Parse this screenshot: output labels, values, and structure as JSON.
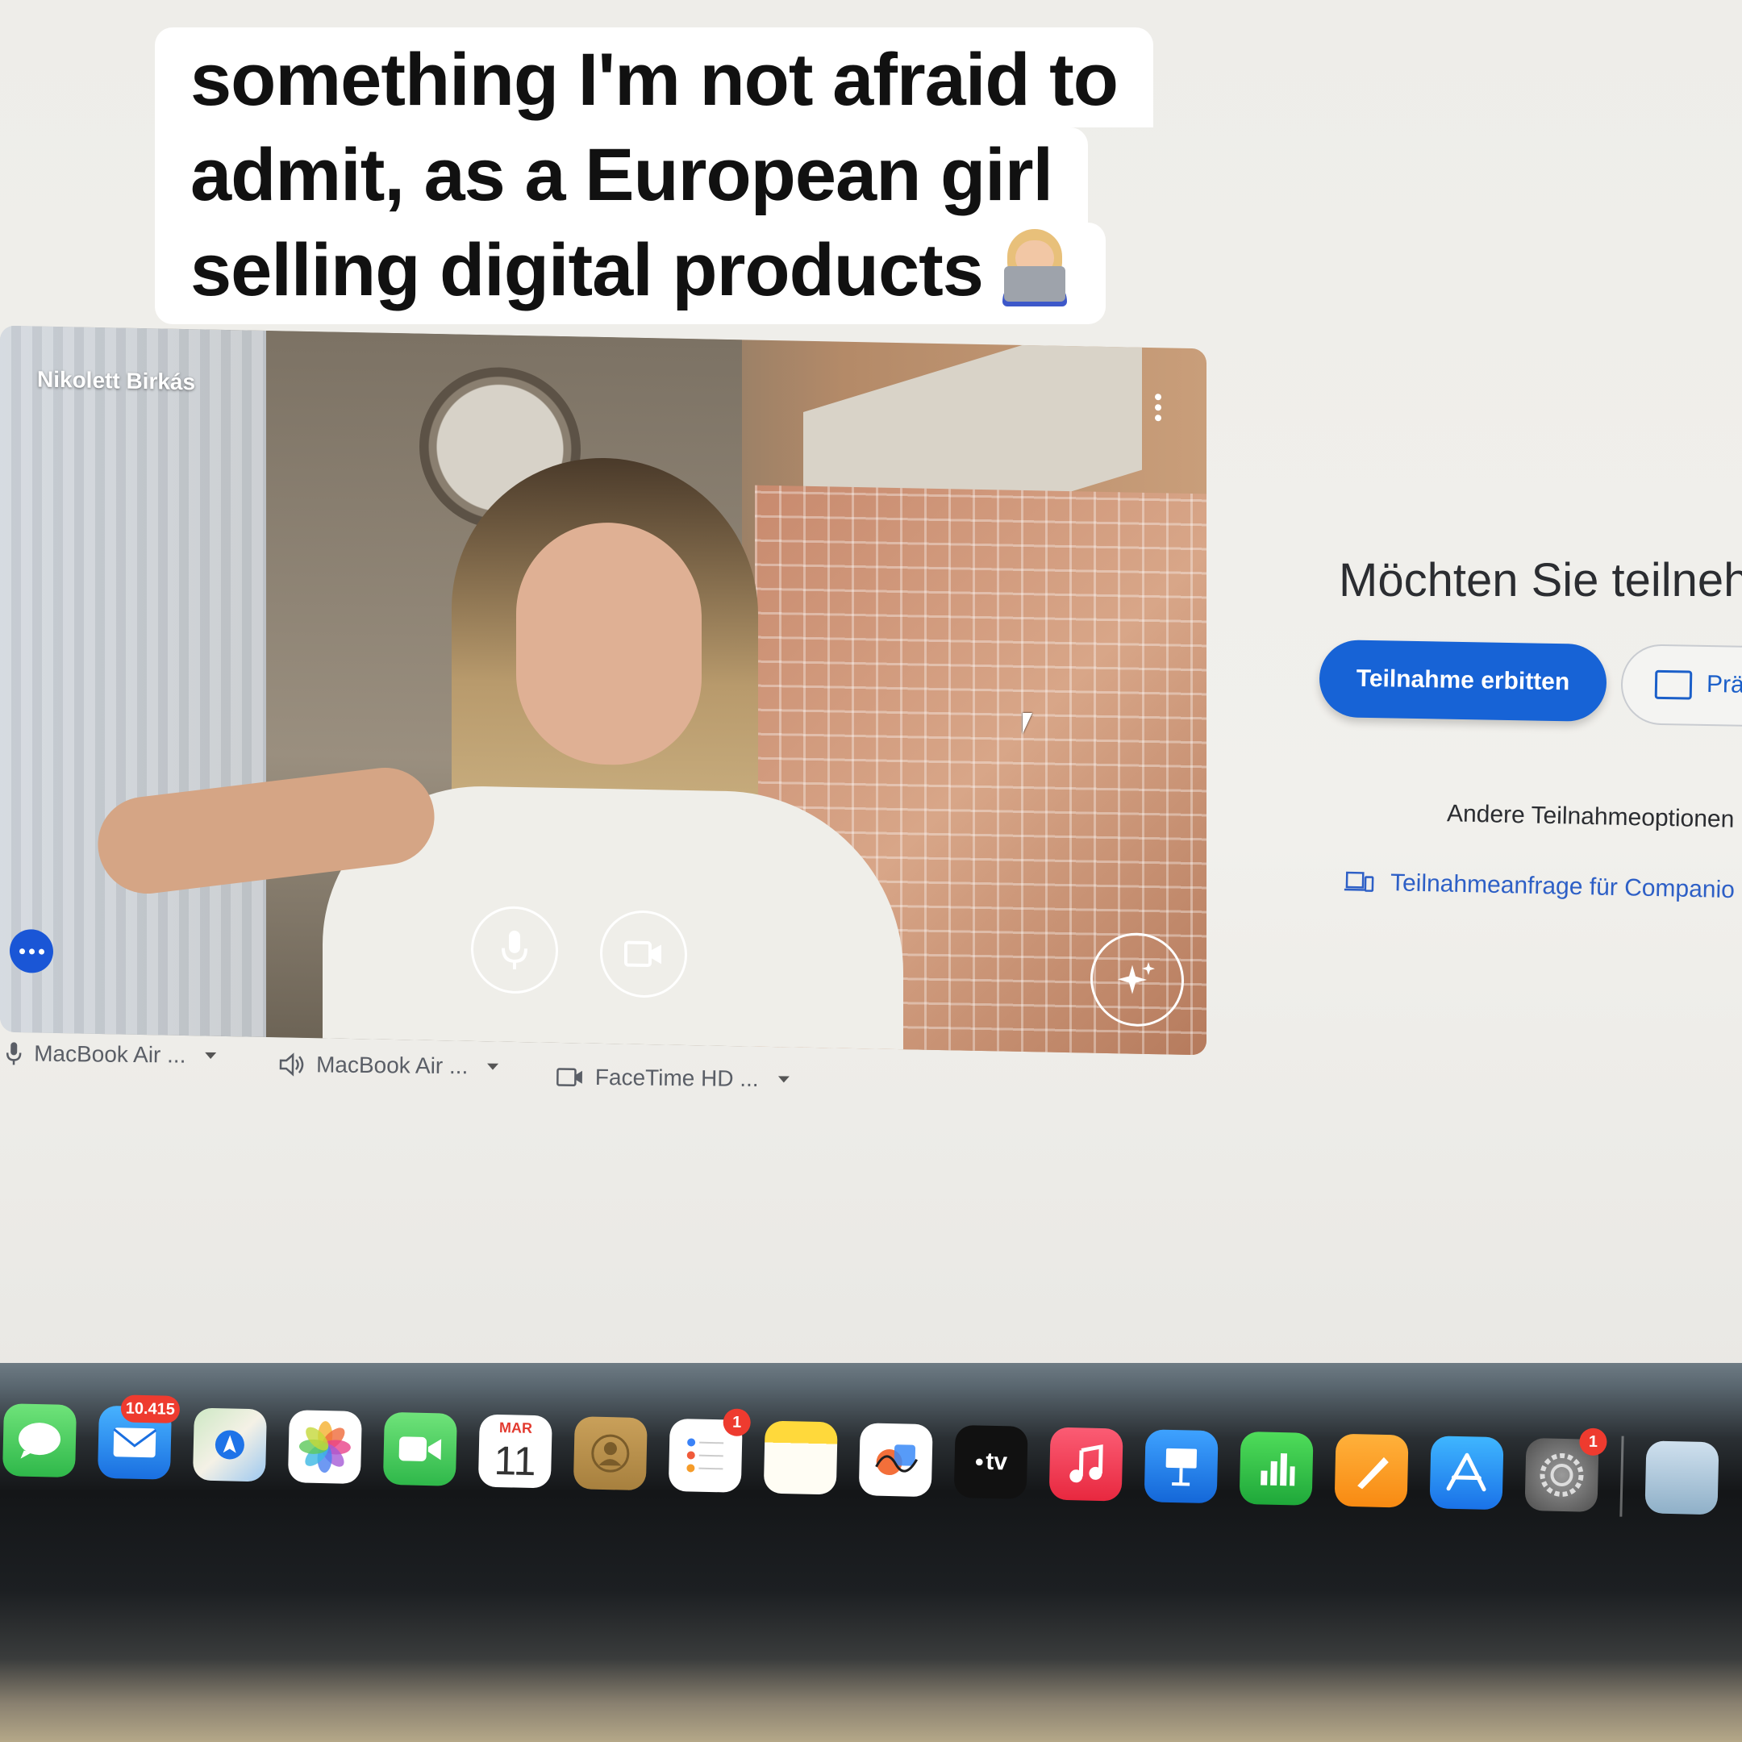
{
  "caption": {
    "line1": "something I'm not afraid to",
    "line2": "admit, as a European girl",
    "line3": "selling digital products"
  },
  "video_preview": {
    "participant_name": "Nikolett Birkás"
  },
  "devices": {
    "microphone": "MacBook Air ...",
    "speaker": "MacBook Air ...",
    "camera": "FaceTime HD ..."
  },
  "join_panel": {
    "title": "Möchten Sie teilneh",
    "ask_to_join": "Teilnahme erbitten",
    "present": "Prä",
    "other_options": "Andere Teilnahmeoptionen",
    "companion_request": "Teilnahmeanfrage für Companio"
  },
  "dock": {
    "mail_badge": "10.415",
    "calendar_month": "MAR",
    "calendar_day": "11",
    "reminders_badge": "1",
    "tv_label": "tv",
    "settings_badge": "1"
  },
  "colors": {
    "accent_blue": "#1763d6",
    "badge_red": "#ee3b2f",
    "screen_bg": "#eeede9"
  }
}
